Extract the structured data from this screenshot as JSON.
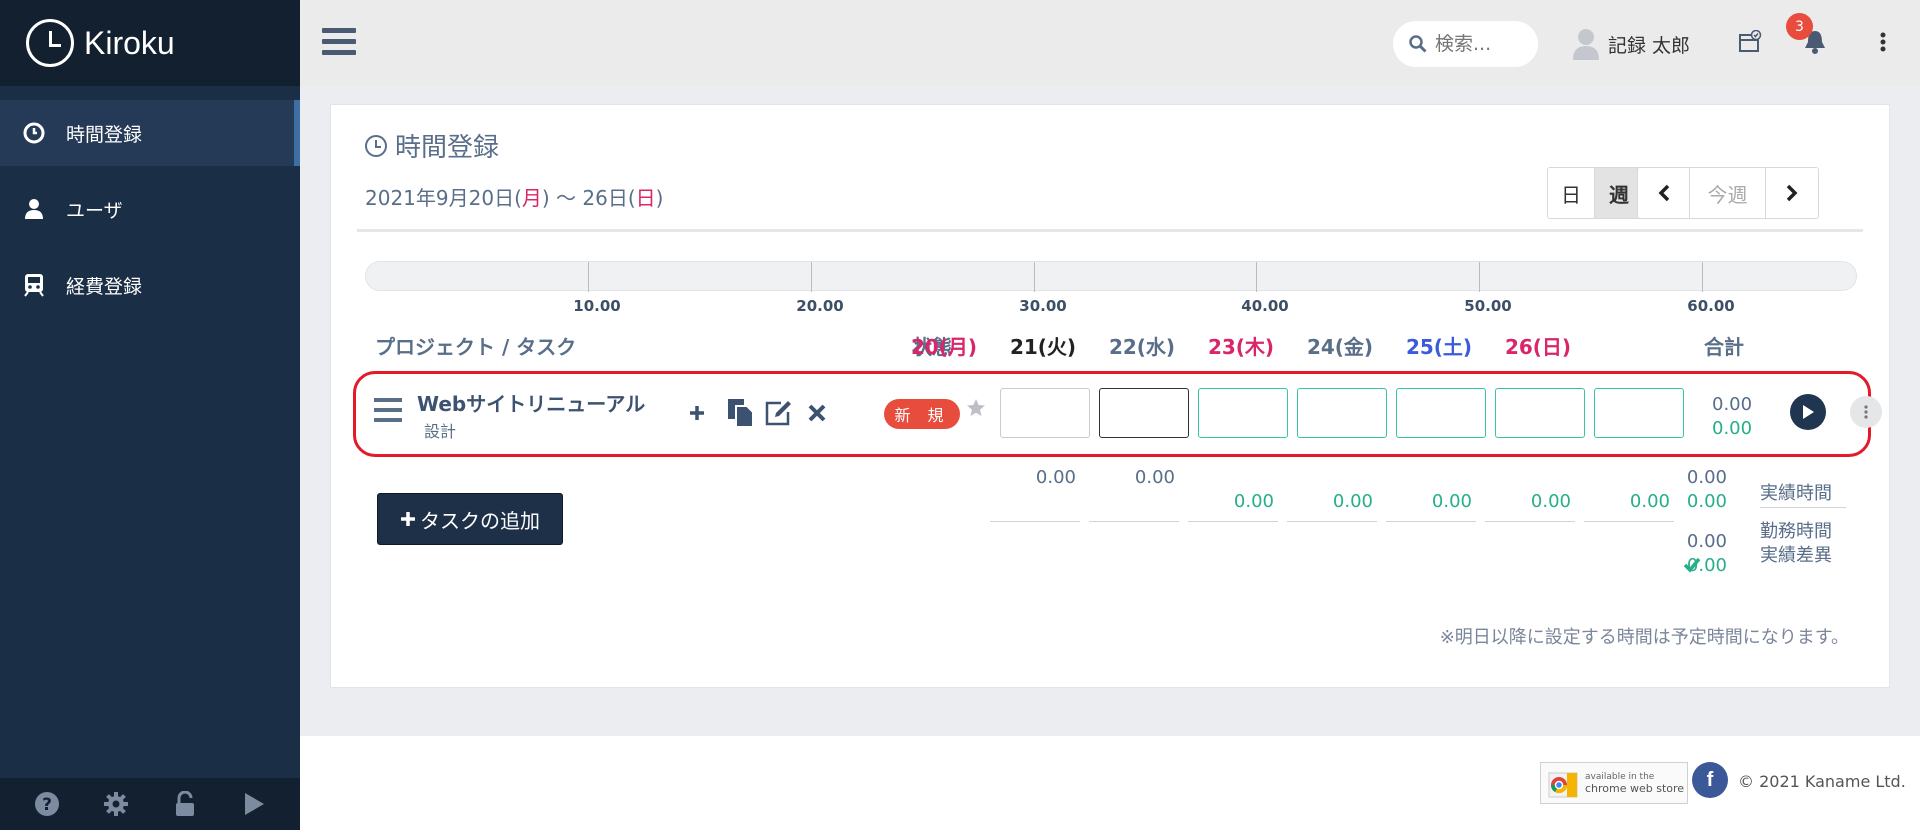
{
  "app": {
    "name": "Kiroku"
  },
  "sidebar": {
    "items": [
      {
        "label": "時間登録",
        "icon": "clock-icon"
      },
      {
        "label": "ユーザ",
        "icon": "user-icon"
      },
      {
        "label": "経費登録",
        "icon": "train-icon"
      }
    ],
    "footer_icons": [
      "help-icon",
      "gear-icon",
      "unlock-icon",
      "play-icon"
    ]
  },
  "topbar": {
    "search_placeholder": "検索...",
    "user_name": "記録 太郎",
    "notification_count": "3"
  },
  "page": {
    "title": "時間登録",
    "date_prefix": "2021年9月20日(",
    "date_mon": "月",
    "date_mid": ") 〜 26日(",
    "date_sun": "日",
    "date_suffix": ")",
    "view_day": "日",
    "view_week": "週",
    "this_week": "今週"
  },
  "gauge": {
    "ticks": [
      "10.00",
      "20.00",
      "30.00",
      "40.00",
      "50.00",
      "60.00"
    ]
  },
  "table": {
    "col_project": "プロジェクト / タスク",
    "col_status": "状態",
    "days": [
      {
        "label": "20(月)",
        "color": "#d9256a"
      },
      {
        "label": "21(火)",
        "color": "#222222"
      },
      {
        "label": "22(水)",
        "color": "#596e89"
      },
      {
        "label": "23(木)",
        "color": "#d9256a"
      },
      {
        "label": "24(金)",
        "color": "#596e89"
      },
      {
        "label": "25(土)",
        "color": "#3b5bdb"
      },
      {
        "label": "26(日)",
        "color": "#d9256a"
      }
    ],
    "col_total": "合計"
  },
  "task": {
    "name": "Webサイトリニューアル",
    "sub": "設計",
    "status": "新 規",
    "total_actual": "0.00",
    "total_work": "0.00"
  },
  "summary": {
    "add_task": "タスクの追加",
    "day_actual": [
      "0.00",
      "0.00",
      "",
      "",
      "",
      "",
      ""
    ],
    "day_work": [
      "",
      "",
      "0.00",
      "0.00",
      "0.00",
      "0.00",
      "0.00"
    ],
    "total_actual": "0.00",
    "total_work": "0.00",
    "total_diff_a": "0.00",
    "total_diff_b": "0.00",
    "label_actual": "実績時間",
    "label_work": "勤務時間",
    "label_diff": "実績差異"
  },
  "note": "※明日以降に設定する時間は予定時間になります。",
  "footer": {
    "cws_small": "available in the",
    "cws_big": "chrome web store",
    "copyright": "© 2021 Kaname Ltd."
  }
}
